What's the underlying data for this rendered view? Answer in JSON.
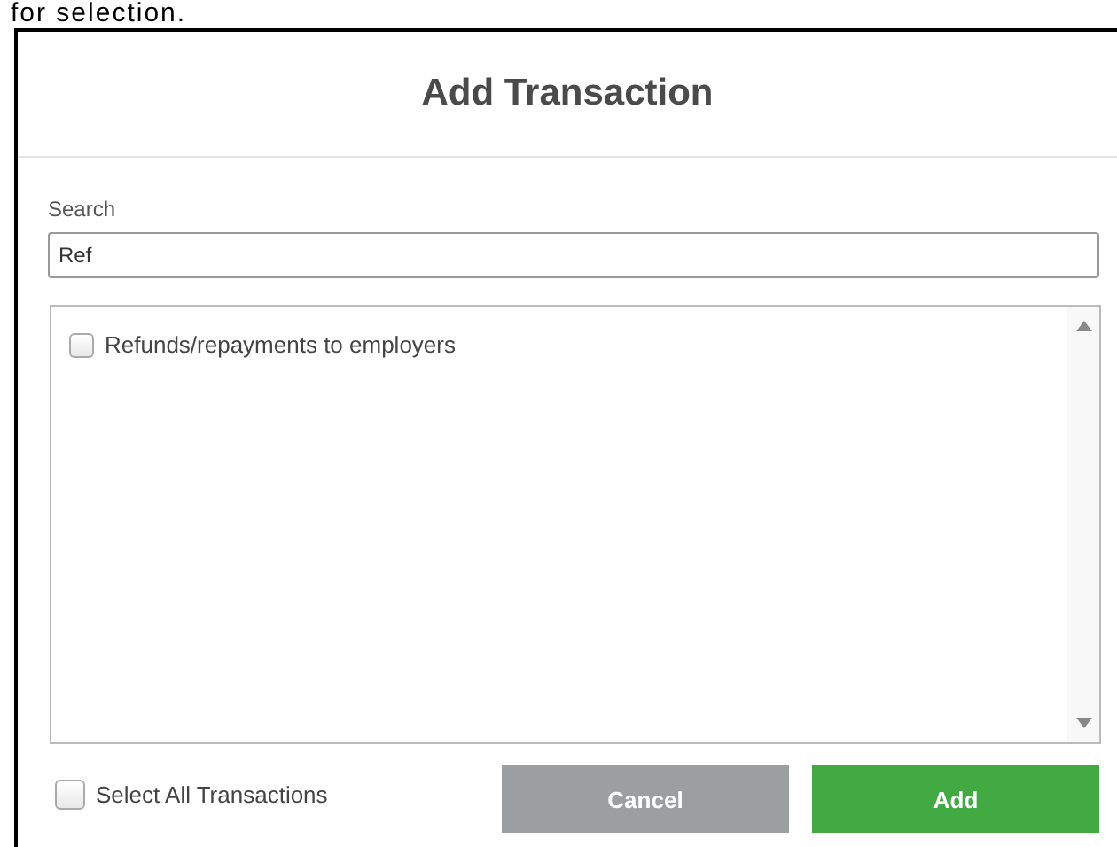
{
  "page_text": "for selection.",
  "dialog": {
    "title": "Add Transaction",
    "search": {
      "label": "Search",
      "value": "Ref"
    },
    "items": [
      {
        "label": "Refunds/repayments to employers",
        "checked": false
      }
    ],
    "select_all": {
      "label": "Select All Transactions",
      "checked": false
    },
    "buttons": [
      {
        "label": "Cancel",
        "kind": "secondary"
      },
      {
        "label": "Add",
        "kind": "primary"
      }
    ]
  }
}
